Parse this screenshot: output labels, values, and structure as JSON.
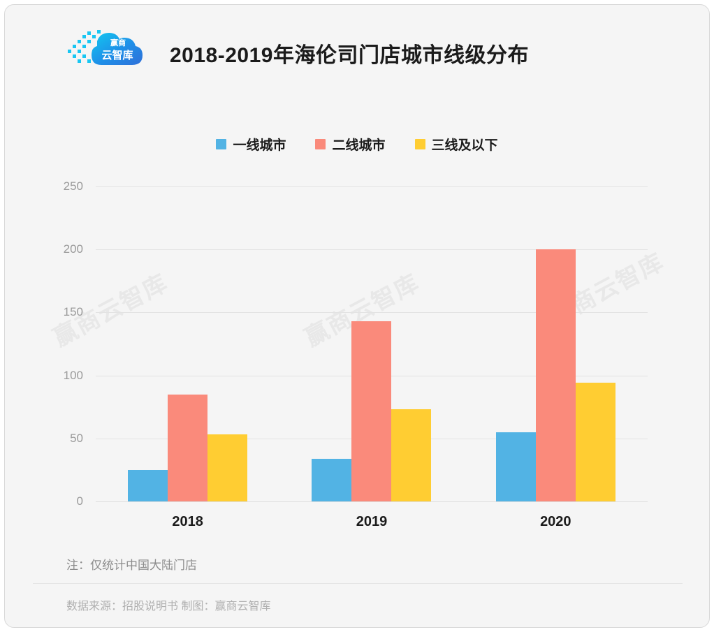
{
  "header": {
    "title": "2018-2019年海伦司门店城市线级分布",
    "logo_text_top": "赢商",
    "logo_text_bottom": "云智库"
  },
  "watermark": {
    "text": "赢商云智库"
  },
  "footer": {
    "note": "注：仅统计中国大陆门店",
    "source": "数据来源：招股说明书  制图：赢商云智库"
  },
  "chart_data": {
    "type": "bar",
    "title": "2018-2019年海伦司门店城市线级分布",
    "xlabel": "",
    "ylabel": "",
    "categories": [
      "2018",
      "2019",
      "2020"
    ],
    "series": [
      {
        "name": "一线城市",
        "color": "#52b3e4",
        "values": [
          25,
          34,
          55
        ]
      },
      {
        "name": "二线城市",
        "color": "#fa8a7b",
        "values": [
          85,
          143,
          200
        ]
      },
      {
        "name": "三线及以下",
        "color": "#ffcd32",
        "values": [
          53,
          73,
          94
        ]
      }
    ],
    "ylim": [
      0,
      250
    ],
    "yticks": [
      0,
      50,
      100,
      150,
      200,
      250
    ],
    "grid": true,
    "legend_position": "top-center"
  }
}
